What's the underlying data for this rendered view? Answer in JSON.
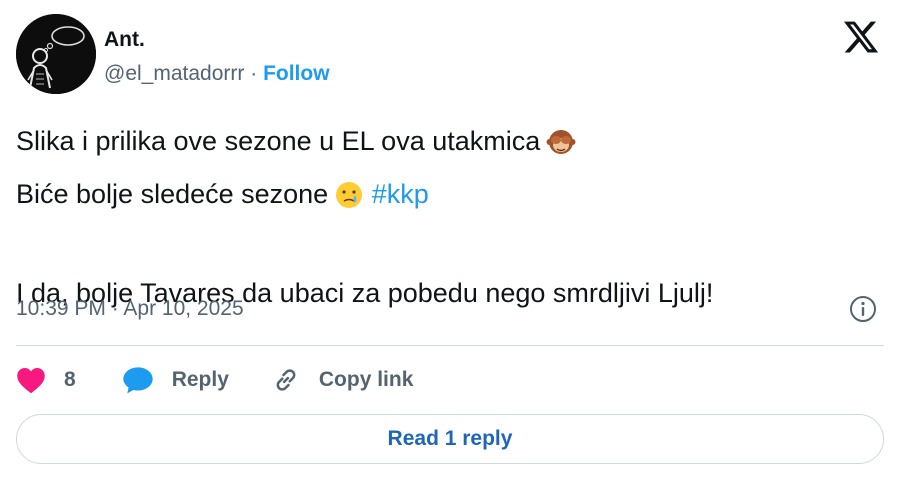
{
  "author": {
    "name": "Ant.",
    "handle": "@el_matadorrr",
    "separator": "·",
    "follow_label": "Follow",
    "avatar_icon": "avatar-figure-icon"
  },
  "brand": {
    "logo_icon": "x-logo-icon"
  },
  "tweet": {
    "line1": "Slika i prilika ove sezone u EL ova utakmica",
    "line1_emoji": "see-no-evil-monkey-icon",
    "line2": "Biće bolje sledeće sezone",
    "line2_emoji": "crying-face-icon",
    "hashtag": "#kkp",
    "line3": "I da, bolje Tavares da ubaci za pobedu nego smrdljivi Ljulj!"
  },
  "meta": {
    "timestamp": "10:39 PM · Apr 10, 2025",
    "info_icon": "info-icon"
  },
  "actions": {
    "like_count": "8",
    "reply_label": "Reply",
    "copy_link_label": "Copy link"
  },
  "read_replies_label": "Read 1 reply",
  "colors": {
    "accent": "#1d9bf0",
    "like": "#f91880",
    "text": "#0f1419",
    "muted": "#536471",
    "border": "#cfd9de"
  }
}
